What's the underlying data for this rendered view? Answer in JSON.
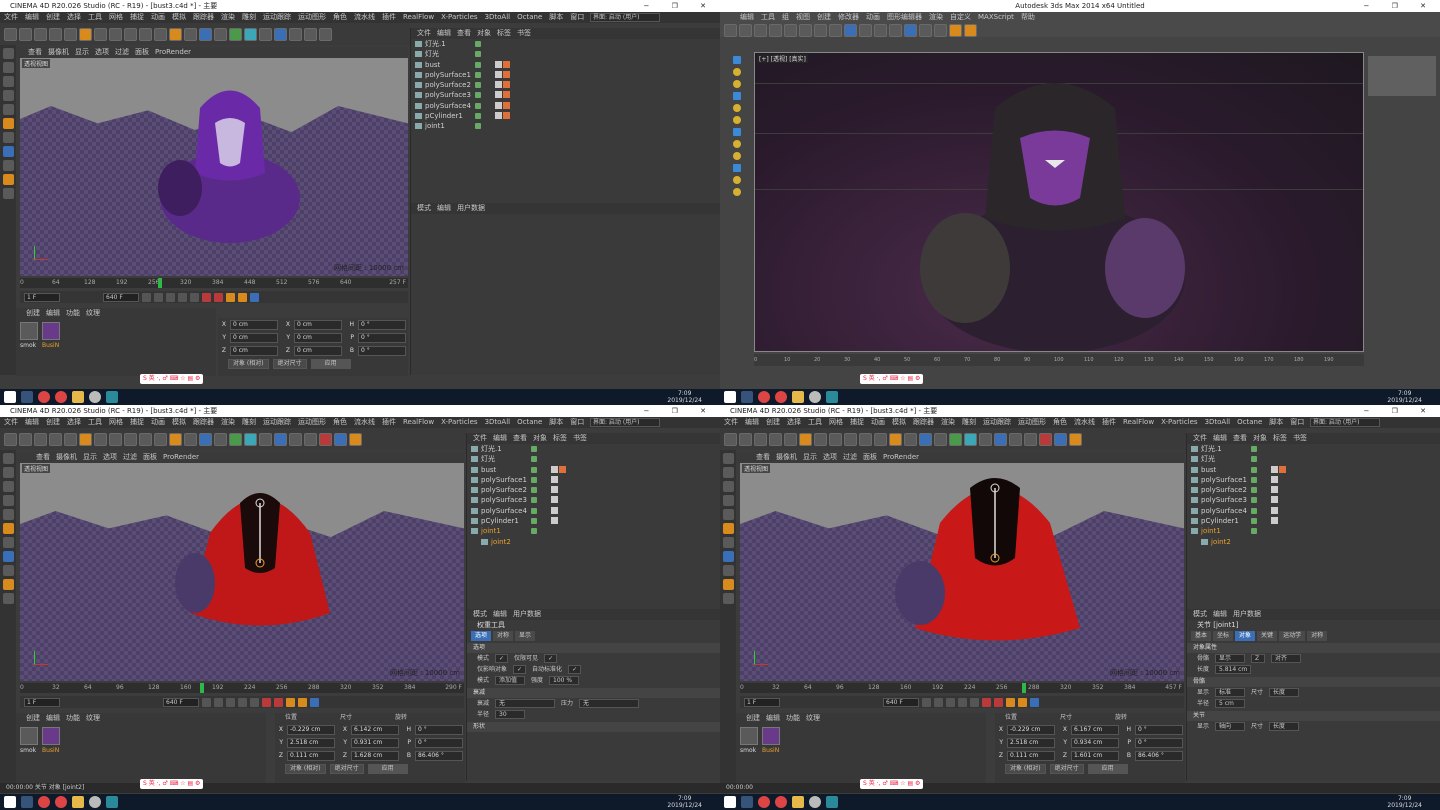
{
  "c4d": {
    "title": "CINEMA 4D R20.026 Studio (RC - R19) - [bust3.c4d *] - 主要",
    "layout_label": "界面: 启动 (用户)",
    "menus": [
      "文件",
      "编辑",
      "创建",
      "选择",
      "工具",
      "网格",
      "捕捉",
      "动画",
      "模拟",
      "跟踪器",
      "渲染",
      "雕刻",
      "运动跟踪",
      "运动图形",
      "角色",
      "流水线",
      "插件",
      "RealFlow",
      "X-Particles",
      "3DtoAll",
      "Octane",
      "脚本",
      "窗口",
      "帮助"
    ],
    "viewport_menu": [
      "查看",
      "摄像机",
      "显示",
      "选项",
      "过滤",
      "面板",
      "ProRender"
    ],
    "viewport_label": "透视视图",
    "grid_label": "网格间距 : 10000 cm",
    "object_menu": [
      "文件",
      "编辑",
      "查看",
      "对象",
      "标签",
      "书签"
    ],
    "objects": [
      {
        "name": "灯光.1",
        "selected": false
      },
      {
        "name": "灯光",
        "selected": false
      },
      {
        "name": "bust",
        "selected": false
      },
      {
        "name": "polySurface1",
        "selected": false
      },
      {
        "name": "polySurface2",
        "selected": false
      },
      {
        "name": "polySurface3",
        "selected": false
      },
      {
        "name": "polySurface4",
        "selected": false
      },
      {
        "name": "pCylinder1",
        "selected": false
      },
      {
        "name": "joint1",
        "selected": false
      }
    ],
    "objects_bl": [
      {
        "name": "灯光.1",
        "selected": false
      },
      {
        "name": "灯光",
        "selected": false
      },
      {
        "name": "bust",
        "selected": false
      },
      {
        "name": "polySurface1",
        "selected": false
      },
      {
        "name": "polySurface2",
        "selected": false
      },
      {
        "name": "polySurface3",
        "selected": false
      },
      {
        "name": "polySurface4",
        "selected": false
      },
      {
        "name": "pCylinder1",
        "selected": false
      },
      {
        "name": "joint1",
        "selected": true
      },
      {
        "name": "joint2",
        "selected": true
      }
    ],
    "attr_menu": [
      "模式",
      "编辑",
      "用户数据"
    ],
    "material_menu": [
      "创建",
      "编辑",
      "功能",
      "纹理"
    ],
    "materials": [
      "smok",
      "BusiN"
    ],
    "coord_headers": [
      "位置",
      "尺寸",
      "旋转"
    ],
    "timeline_ticks": [
      "0",
      "32",
      "64",
      "96",
      "128",
      "160",
      "192",
      "224",
      "256",
      "288",
      "320",
      "352",
      "384",
      "416",
      "448",
      "480",
      "512",
      "544",
      "576",
      "608",
      "640"
    ],
    "tl_top": {
      "frame_end": "257 F",
      "current": "1 F",
      "max": "640 F"
    },
    "tl_bl": {
      "frame_end": "290 F",
      "current": "1 F",
      "max": "640 F"
    },
    "tl_br": {
      "frame_end": "457 F",
      "current": "1 F",
      "max": "640 F"
    },
    "coords_top": {
      "x": "0 cm",
      "y": "0 cm",
      "z": "0 cm",
      "sx": "0 cm",
      "sy": "0 cm",
      "sz": "0 cm",
      "h": "0 °",
      "p": "0 °",
      "b": "0 °",
      "mode1": "对象 (相对)",
      "mode2": "绝对尺寸",
      "apply": "应用"
    },
    "coords_bl": {
      "x": "-0.229 cm",
      "y": "2.518 cm",
      "z": "0.111 cm",
      "sx": "6.142 cm",
      "sy": "0.931 cm",
      "sz": "1.628 cm",
      "h": "0 °",
      "p": "0 °",
      "b": "86.406 °",
      "mode1": "对象 (相对)",
      "mode2": "绝对尺寸",
      "apply": "应用"
    },
    "coords_br": {
      "x": "-0.229 cm",
      "y": "2.518 cm",
      "z": "0.111 cm",
      "sx": "6.167 cm",
      "sy": "0.934 cm",
      "sz": "1.601 cm",
      "h": "0 °",
      "p": "0 °",
      "b": "86.406 °",
      "mode1": "对象 (相对)",
      "mode2": "绝对尺寸",
      "apply": "应用"
    },
    "attr_bl": {
      "title": "权重工具",
      "tabs": [
        "选项",
        "对称",
        "显示"
      ],
      "section1": "选项",
      "rows": [
        [
          "模式",
          "✓",
          "仅限可见",
          "✓"
        ],
        [
          "仅影响对象",
          "✓",
          "自动标准化",
          "✓"
        ],
        [
          "模式",
          "添加值",
          "强度",
          "100 %"
        ]
      ],
      "section2": "衰减",
      "rows2": [
        [
          "衰减",
          "无",
          "压力",
          "无"
        ],
        [
          "半径",
          "30",
          "",
          " "
        ]
      ],
      "section3": "形状"
    },
    "attr_br": {
      "title": "关节 [joint1]",
      "tabs": [
        "基本",
        "坐标",
        "对象",
        "关键",
        "运动学",
        "对称"
      ],
      "section1": "对象属性",
      "rows": [
        [
          "骨骼",
          "显示",
          "Z",
          "对齐"
        ],
        [
          "长度",
          "5.814 cm",
          "",
          ""
        ]
      ],
      "section2": "骨骼",
      "rows2": [
        [
          "显示",
          "标准",
          "尺寸",
          "长度"
        ],
        [
          "半径",
          "5 cm",
          "",
          ""
        ]
      ],
      "section3": "关节",
      "rows3": [
        [
          "显示",
          "轴向",
          "尺寸",
          "长度"
        ]
      ]
    },
    "status_bl": "00:00:00  关节 对象 [joint2]",
    "status_br": "00:00:00"
  },
  "max": {
    "title": "Autodesk 3ds Max 2014 x64   Untitled",
    "menus": [
      "编辑",
      "工具",
      "组",
      "视图",
      "创建",
      "修改器",
      "动画",
      "图形编辑器",
      "渲染",
      "自定义",
      "MAXScript",
      "帮助"
    ],
    "viewport_label": "[+] [透视] [真实]",
    "ruler": [
      "0",
      "10",
      "20",
      "30",
      "40",
      "50",
      "60",
      "70",
      "80",
      "90",
      "100",
      "110",
      "120",
      "130",
      "140",
      "150",
      "160",
      "170",
      "180",
      "190",
      "200"
    ]
  },
  "taskbar": {
    "time": "7:09",
    "date": "2019/12/24"
  },
  "ime_label": "S 英 ·, ♂ ⌨ ☆ ▤ ⚙"
}
